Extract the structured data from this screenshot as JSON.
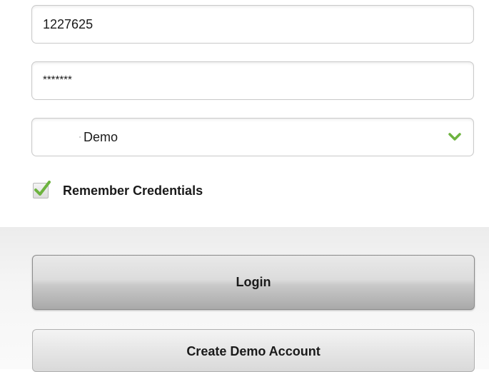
{
  "login_form": {
    "username_value": "1227625",
    "password_value": "*******",
    "server_selected": "Demo",
    "remember_label": "Remember Credentials",
    "remember_checked": true
  },
  "buttons": {
    "login_label": "Login",
    "create_demo_label": "Create Demo Account"
  },
  "colors": {
    "check_green": "#6db33f",
    "chevron_green": "#6db33f"
  },
  "icons": {
    "dropdown": "chevron-down-icon",
    "checkbox": "checkmark-icon"
  }
}
